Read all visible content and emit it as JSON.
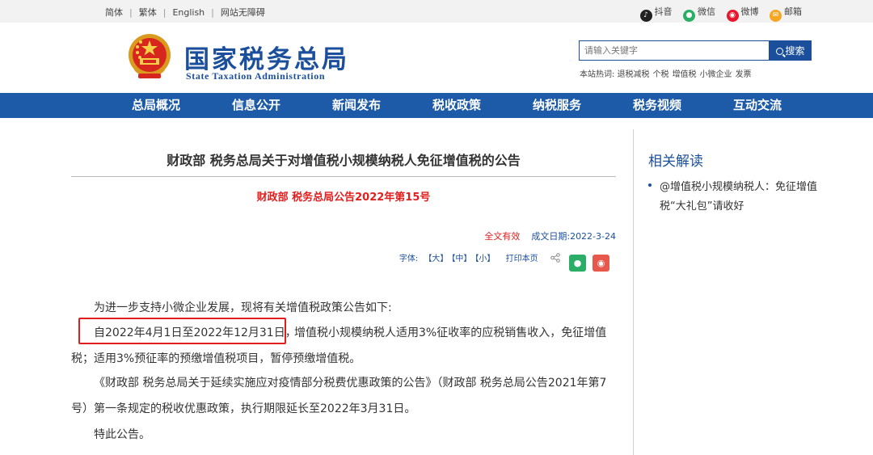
{
  "topbar": {
    "lang": [
      "简体",
      "繁体",
      "English",
      "网站无障碍"
    ],
    "social": [
      {
        "icon": "douyin-icon",
        "label": "抖音"
      },
      {
        "icon": "wechat-icon",
        "label": "微信"
      },
      {
        "icon": "weibo-icon",
        "label": "微博"
      },
      {
        "icon": "mail-icon",
        "label": "邮箱"
      }
    ]
  },
  "header": {
    "title": "国家税务总局",
    "subtitle": "State Taxation Administration",
    "search_placeholder": "请输入关键字",
    "search_button": "搜索",
    "hot_label": "本站热词:",
    "hot_words": [
      "退税减税",
      "个税",
      "增值税",
      "小微企业",
      "发票"
    ]
  },
  "nav": [
    "总局概况",
    "信息公开",
    "新闻发布",
    "税收政策",
    "纳税服务",
    "税务视频",
    "互动交流"
  ],
  "article": {
    "title": "财政部 税务总局关于对增值税小规模纳税人免征增值税的公告",
    "doc_no": "财政部 税务总局公告2022年第15号",
    "validity": "全文有效",
    "date": "成文日期:2022-3-24",
    "font_label": "字体:",
    "font_sizes": [
      "【大】",
      "【中】",
      "【小】"
    ],
    "print": "打印本页",
    "paragraphs": {
      "p1": "为进一步支持小微企业发展，现将有关增值税政策公告如下:",
      "p2_highlight": "自2022年4月1日至2022年12月31日，",
      "p2_rest": "增值税小规模纳税人适用3%征收率的应税销售收入，免征增值",
      "p2_line2": "税；适用3%预征率的预缴增值税项目，暂停预缴增值税。",
      "p3_line1": "《财政部 税务总局关于延续实施应对疫情部分税费优惠政策的公告》（财政部 税务总局公告2021年第7",
      "p3_line2": "号）第一条规定的税收优惠政策，执行期限延长至2022年3月31日。",
      "p4": "特此公告。"
    }
  },
  "sidebar": {
    "title": "相关解读",
    "items": [
      {
        "label": "@增值税小规模纳税人：免征增值税“大礼包”请收好"
      }
    ]
  },
  "colors": {
    "brand_blue": "#1d5ba8",
    "highlight_red": "#e11e1e"
  }
}
